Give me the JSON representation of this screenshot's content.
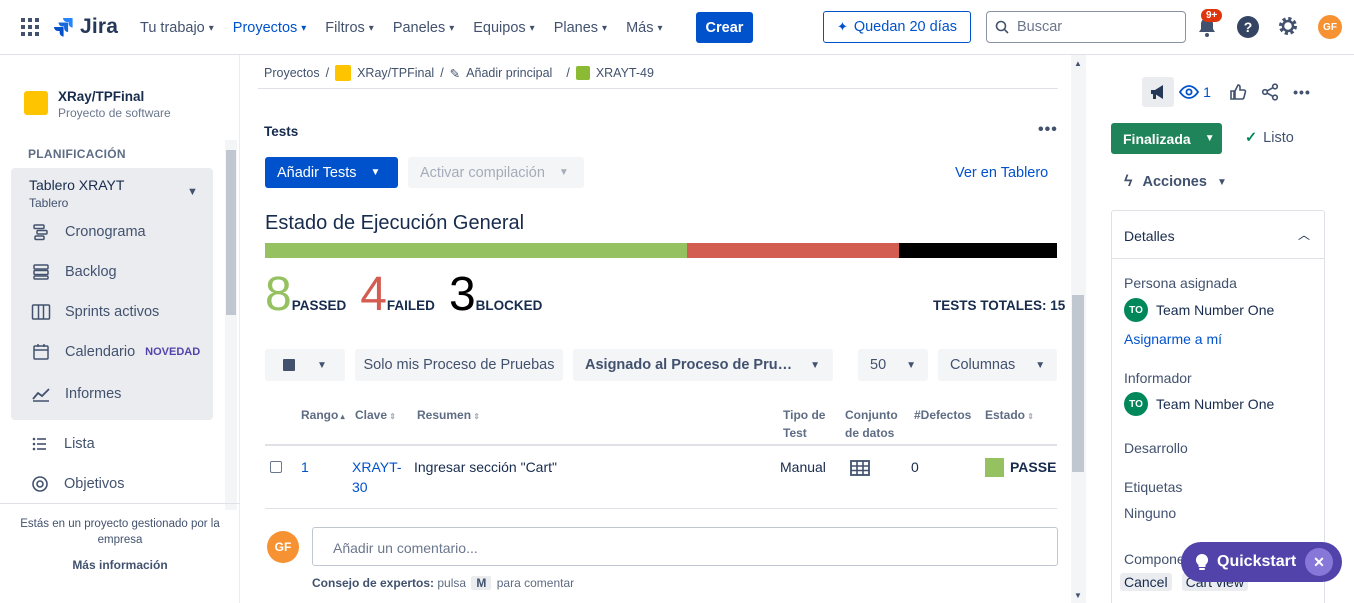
{
  "topbar": {
    "logo": "Jira",
    "nav": [
      {
        "label": "Tu trabajo",
        "active": false
      },
      {
        "label": "Proyectos",
        "active": true
      },
      {
        "label": "Filtros",
        "active": false
      },
      {
        "label": "Paneles",
        "active": false
      },
      {
        "label": "Equipos",
        "active": false
      },
      {
        "label": "Planes",
        "active": false
      },
      {
        "label": "Más",
        "active": false
      }
    ],
    "create_label": "Crear",
    "trial_label": "Quedan 20 días",
    "search_placeholder": "Buscar",
    "notifications_badge": "9+",
    "avatar_initials": "GF"
  },
  "sidebar": {
    "project_name": "XRay/TPFinal",
    "project_type": "Proyecto de software",
    "section_title": "PLANIFICACIÓN",
    "board_title": "Tablero XRAYT",
    "board_sub": "Tablero",
    "items": [
      {
        "label": "Cronograma",
        "icon": "timeline-icon"
      },
      {
        "label": "Backlog",
        "icon": "backlog-icon"
      },
      {
        "label": "Sprints activos",
        "icon": "board-icon"
      },
      {
        "label": "Calendario",
        "icon": "calendar-icon",
        "badge": "NOVEDAD"
      },
      {
        "label": "Informes",
        "icon": "reports-icon"
      }
    ],
    "extra_items": [
      {
        "label": "Lista",
        "icon": "list-icon"
      },
      {
        "label": "Objetivos",
        "icon": "goals-icon"
      }
    ],
    "footer_text": "Estás en un proyecto gestionado por la empresa",
    "footer_link": "Más información"
  },
  "breadcrumbs": [
    "Proyectos",
    "XRay/TPFinal",
    "Añadir principal",
    "XRAYT-49"
  ],
  "tests": {
    "heading": "Tests",
    "add_button": "Añadir Tests",
    "build_button": "Activar compilación",
    "board_link": "Ver en Tablero",
    "status_heading": "Estado de Ejecución General",
    "passed_count": "8",
    "passed_label": "PASSED",
    "failed_count": "4",
    "failed_label": "FAILED",
    "blocked_count": "3",
    "blocked_label": "BLOCKED",
    "total_label": "TESTS TOTALES: 15",
    "progress": {
      "passed": 8,
      "failed": 4,
      "blocked": 3,
      "total": 15
    },
    "colors": {
      "passed": "#95C160",
      "failed": "#D45D52",
      "blocked": "#000000"
    },
    "filters": {
      "mine": "Solo mis Proceso de Pruebas",
      "assigned": "Asignado al Proceso de Pru…",
      "page_size": "50",
      "columns": "Columnas"
    },
    "columns": [
      "Rango",
      "Clave",
      "Resumen",
      "Tipo de Test",
      "Conjunto de datos",
      "#Defectos",
      "Estado"
    ],
    "rows": [
      {
        "rank": "1",
        "key": "XRAYT-30",
        "summary": "Ingresar sección \"Cart\"",
        "type": "Manual",
        "defects": "0",
        "status": "PASSED"
      }
    ]
  },
  "comment": {
    "avatar": "GF",
    "placeholder": "Añadir un comentario...",
    "tip_prefix": "Consejo de expertos:",
    "tip_press": "pulsa",
    "tip_key": "M",
    "tip_suffix": "para comentar"
  },
  "right_panel": {
    "watchers": "1",
    "status_button": "Finalizada",
    "resolution": "Listo",
    "actions": "Acciones",
    "details_title": "Detalles",
    "assignee_label": "Persona asignada",
    "assignee": "Team Number One",
    "assignee_initials": "TO",
    "assign_me": "Asignarme a mí",
    "reporter_label": "Informador",
    "reporter": "Team Number One",
    "development_label": "Desarrollo",
    "labels_label": "Etiquetas",
    "labels_value": "Ninguno",
    "components_label": "Compone",
    "cancel": "Cancel",
    "cart_view": "Cart view"
  },
  "quickstart": "Quickstart"
}
